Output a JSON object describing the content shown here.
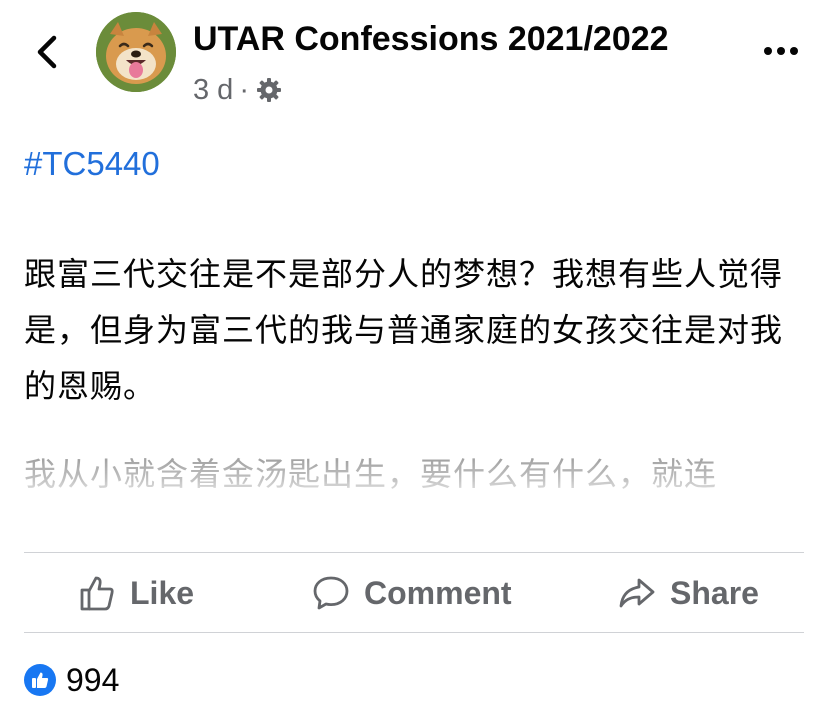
{
  "header": {
    "page_name": "UTAR Confessions 2021/2022",
    "time": "3 d",
    "separator": "·",
    "icons": [
      "back-arrow-icon",
      "dog-avatar",
      "gear-icon",
      "more-icon"
    ]
  },
  "post": {
    "hashtag": "#TC5440",
    "paragraphs": [
      "跟富三代交往是不是部分人的梦想？我想有些人觉得是，但身为富三代的我与普通家庭的女孩交往是对我的恩赐。"
    ],
    "faded_line": "我从小就含着金汤匙出生，要什么有什么，就连"
  },
  "actions": {
    "like": "Like",
    "comment": "Comment",
    "share": "Share"
  },
  "reactions": {
    "count": "994"
  },
  "colors": {
    "hashtag": "#216fdb",
    "muted": "#65676b",
    "like_badge": "#1877f2"
  }
}
